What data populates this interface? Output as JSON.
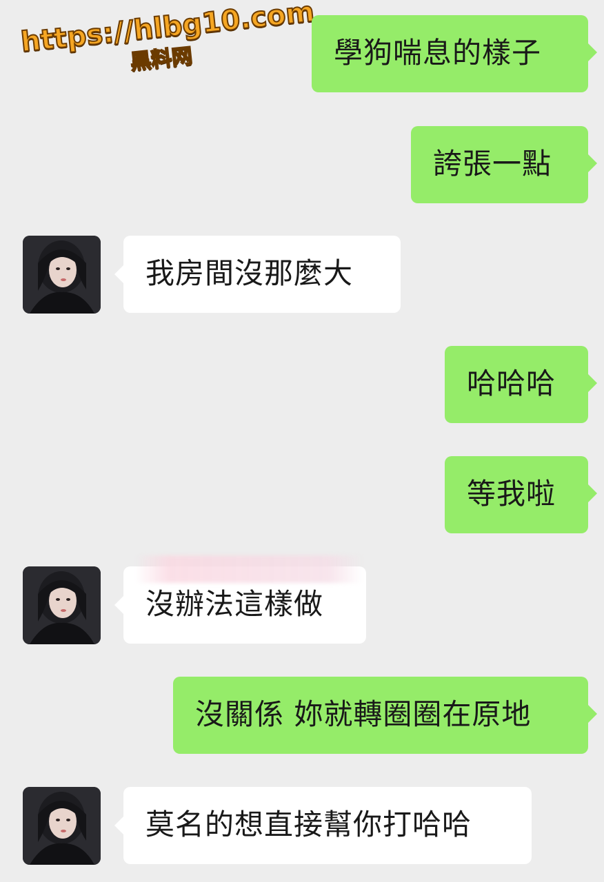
{
  "watermark": {
    "url": "https://hlbg10.com",
    "site": "黑料网"
  },
  "messages": [
    {
      "side": "out",
      "text": "學狗喘息的樣子"
    },
    {
      "side": "out",
      "text": "誇張一點"
    },
    {
      "side": "in",
      "text": "我房間沒那麼大"
    },
    {
      "side": "out",
      "text": "哈哈哈"
    },
    {
      "side": "out",
      "text": "等我啦"
    },
    {
      "side": "in",
      "text": "沒辦法這樣做"
    },
    {
      "side": "out",
      "text": "沒關係 妳就轉圈圈在原地"
    },
    {
      "side": "in",
      "text": "莫名的想直接幫你打哈哈"
    }
  ],
  "colors": {
    "background": "#ededed",
    "outgoing_bubble": "#95ec69",
    "incoming_bubble": "#ffffff",
    "text": "#191919"
  }
}
